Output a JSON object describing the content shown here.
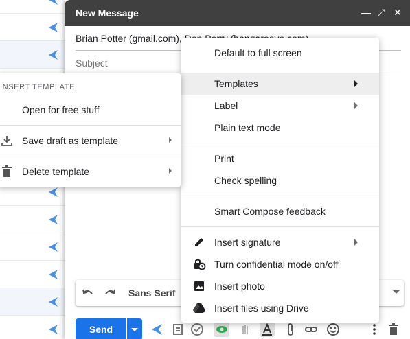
{
  "compose": {
    "title": "New Message",
    "recipients": "Brian Potter (gmail.com), Don Perry (hangaroove.com)",
    "subject_placeholder": "Subject",
    "font": "Sans Serif",
    "send_label": "Send"
  },
  "menu": {
    "items": [
      {
        "label": "Default to full screen"
      },
      {
        "label": "Templates"
      },
      {
        "label": "Label"
      },
      {
        "label": "Plain text mode"
      },
      {
        "label": "Print"
      },
      {
        "label": "Check spelling"
      },
      {
        "label": "Smart Compose feedback"
      },
      {
        "label": "Insert signature"
      },
      {
        "label": "Turn confidential mode on/off"
      },
      {
        "label": "Insert photo"
      },
      {
        "label": "Insert files using Drive"
      }
    ]
  },
  "template_menu": {
    "header": "INSERT TEMPLATE",
    "items": [
      {
        "label": "Open for free stuff"
      },
      {
        "label": "Save draft as template"
      },
      {
        "label": "Delete template"
      }
    ]
  },
  "colors": {
    "send": "#1a73e8",
    "header": "#404040",
    "highlight": "#eeeeee",
    "icon_blue": "#4a90e2"
  }
}
